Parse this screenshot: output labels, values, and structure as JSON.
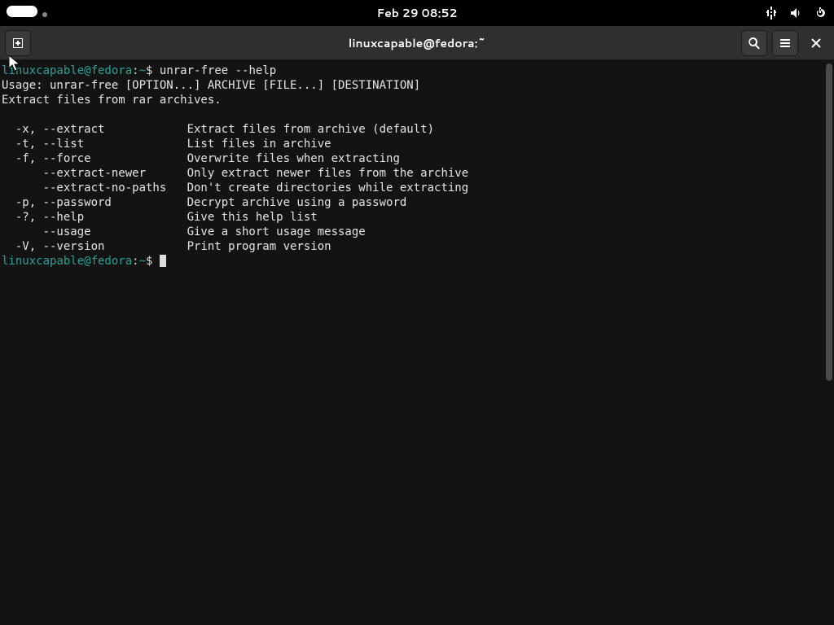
{
  "panel": {
    "datetime": "Feb 29  08:52"
  },
  "headerbar": {
    "title": "linuxcapable@fedora:~"
  },
  "prompt": {
    "user_host": "linuxcapable@fedora",
    "sep": ":",
    "path": "~",
    "dollar": "$"
  },
  "terminal": {
    "command": " unrar-free --help",
    "usage_line": "Usage: unrar-free [OPTION...] ARCHIVE [FILE...] [DESTINATION]",
    "desc_line": "Extract files from rar archives.",
    "options": [
      {
        "flags": "  -x, --extract          ",
        "desc": "  Extract files from archive (default)"
      },
      {
        "flags": "  -t, --list             ",
        "desc": "  List files in archive"
      },
      {
        "flags": "  -f, --force            ",
        "desc": "  Overwrite files when extracting"
      },
      {
        "flags": "      --extract-newer    ",
        "desc": "  Only extract newer files from the archive"
      },
      {
        "flags": "      --extract-no-paths ",
        "desc": "  Don't create directories while extracting"
      },
      {
        "flags": "  -p, --password         ",
        "desc": "  Decrypt archive using a password"
      },
      {
        "flags": "  -?, --help             ",
        "desc": "  Give this help list"
      },
      {
        "flags": "      --usage            ",
        "desc": "  Give a short usage message"
      },
      {
        "flags": "  -V, --version          ",
        "desc": "  Print program version"
      }
    ]
  }
}
